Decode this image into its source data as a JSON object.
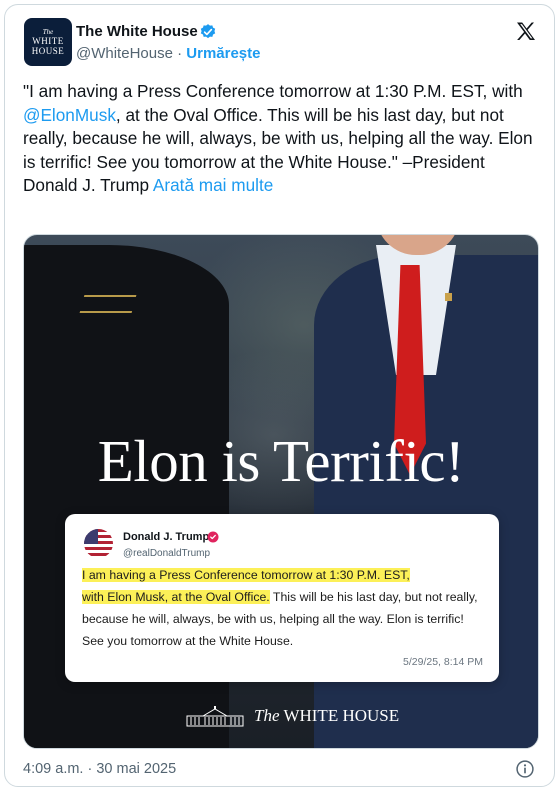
{
  "account": {
    "avatar_text_top": "The",
    "avatar_text_line1": "WHITE",
    "avatar_text_line2": "HOUSE",
    "name": "The White House",
    "handle": "@WhiteHouse",
    "separator": "·",
    "follow_label": "Urmărește"
  },
  "tweet": {
    "text_part1": "\"I am having a Press Conference tomorrow at 1:30 P.M. EST, with ",
    "mention": "@ElonMusk",
    "text_part2": ", at the Oval Office. This will be his last day, but not really, because he will, always, be with us, helping all the way. Elon is terrific! See you tomorrow at the White House.\" –President Donald J. Trump ",
    "show_more": "Arată mai multe",
    "timestamp": "4:09 a.m. · 30 mai 2025"
  },
  "media": {
    "headline": "Elon is Terrific!",
    "embed": {
      "name": "Donald J. Trump",
      "handle": "@realDonaldTrump",
      "text_highlight1": "I am having a Press Conference tomorrow at 1:30 P.M. EST,",
      "text_highlight2": "with Elon Musk, at the Oval Office.",
      "text_rest": " This will be his last day, but not really, because he will, always, be with us, helping all the way. Elon is terrific! See you tomorrow at the White House.",
      "time": "5/29/25, 8:14 PM"
    },
    "footer_the": "The",
    "footer_name": "WHITE HOUSE"
  },
  "colors": {
    "link": "#1d9bf0",
    "verified": "#1d9bf0",
    "highlight": "#fcf058",
    "tie": "#cf1d1d"
  },
  "icons": {
    "verified": "verified-badge-icon",
    "x_logo": "x-logo-icon",
    "info": "info-icon"
  }
}
